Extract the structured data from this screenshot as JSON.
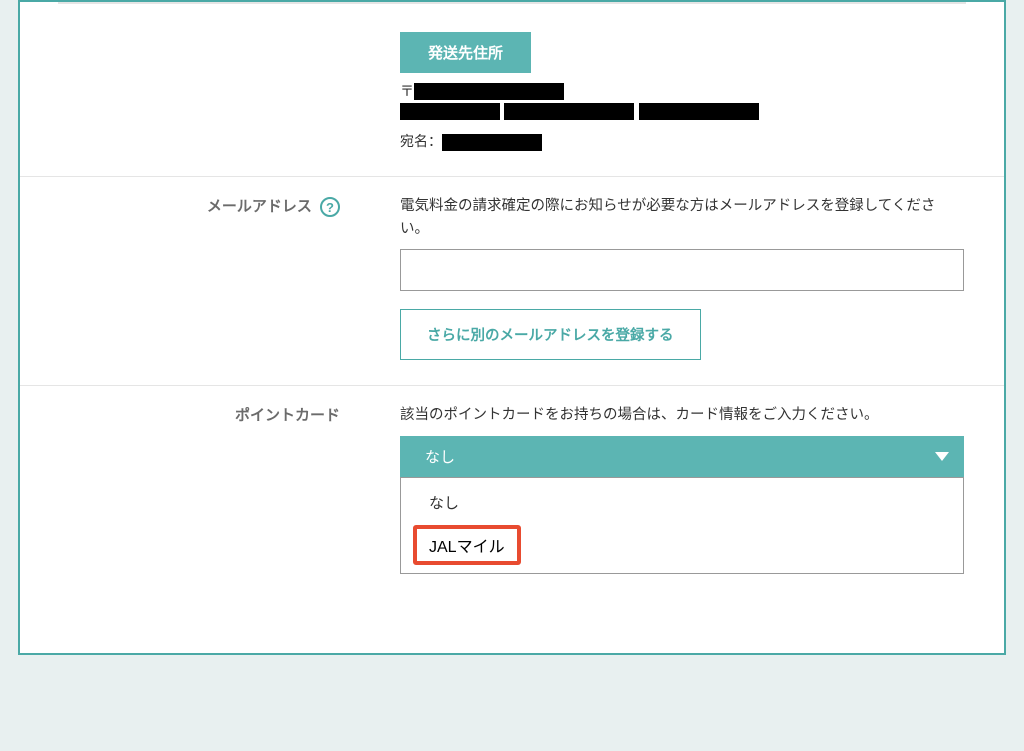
{
  "shipping": {
    "badge_label": "発送先住所",
    "postal_prefix": "〒",
    "name_label": "宛名："
  },
  "email": {
    "label": "メールアドレス",
    "helper": "電気料金の請求確定の際にお知らせが必要な方はメールアドレスを登録してください。",
    "add_button": "さらに別のメールアドレスを登録する"
  },
  "pointcard": {
    "label": "ポイントカード",
    "helper": "該当のポイントカードをお持ちの場合は、カード情報をご入力ください。",
    "selected": "なし",
    "options": {
      "0": "なし",
      "1": "JALマイル"
    }
  },
  "help_glyph": "?"
}
